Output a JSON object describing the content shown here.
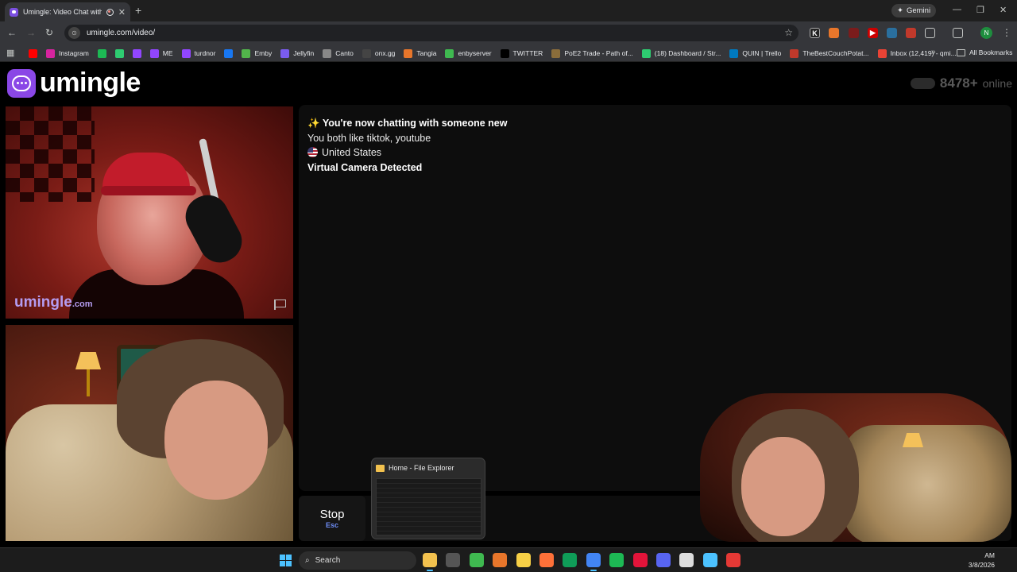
{
  "browser": {
    "tab_title": "Umingle: Video Chat with S",
    "url": "umingle.com/video/",
    "gemini_label": "Gemini",
    "profile_initial": "N",
    "bookmarks": [
      {
        "label": "",
        "color": "#ff0000"
      },
      {
        "label": "Instagram",
        "color": "#d6249f"
      },
      {
        "label": "",
        "color": "#1db954"
      },
      {
        "label": "",
        "color": "#2ecc71"
      },
      {
        "label": "",
        "color": "#9146ff"
      },
      {
        "label": "ME",
        "color": "#9146ff"
      },
      {
        "label": "turdnor",
        "color": "#9146ff"
      },
      {
        "label": "",
        "color": "#1877f2"
      },
      {
        "label": "Emby",
        "color": "#52b54b"
      },
      {
        "label": "Jellyfin",
        "color": "#7a5cf0"
      },
      {
        "label": "Canto",
        "color": "#888888"
      },
      {
        "label": "onx.gg",
        "color": "#444444"
      },
      {
        "label": "Tangia",
        "color": "#e8762b"
      },
      {
        "label": "enbyserver",
        "color": "#3fb950"
      },
      {
        "label": "TWITTER",
        "color": "#000000"
      },
      {
        "label": "PoE2 Trade - Path of...",
        "color": "#8a6d3b"
      },
      {
        "label": "(18) Dashboard / Str...",
        "color": "#2ecc71"
      },
      {
        "label": "QUIN | Trello",
        "color": "#0079bf"
      },
      {
        "label": "TheBestCouchPotat...",
        "color": "#c0392b"
      },
      {
        "label": "Inbox (12,419) - qmi...",
        "color": "#ea4335"
      }
    ],
    "all_bookmarks_label": "All Bookmarks"
  },
  "site": {
    "logo_text": "umingle",
    "online_count": "8478+",
    "online_label": "online",
    "watermark_main": "umingle",
    "watermark_suffix": ".com"
  },
  "chat": {
    "messages": [
      {
        "icon": "✨",
        "text": "You're now chatting with someone new",
        "bold": true
      },
      {
        "icon": "",
        "text": "You both like tiktok, youtube",
        "bold": false
      },
      {
        "icon": "us-flag",
        "text": "United States",
        "bold": false
      },
      {
        "icon": "",
        "text": "Virtual Camera Detected",
        "bold": true
      }
    ],
    "stop_label": "Stop",
    "stop_key": "Esc"
  },
  "taskbar": {
    "search_placeholder": "Search",
    "preview_title": "Home - File Explorer",
    "clock_time": "AM",
    "clock_date": "3/8/2026",
    "apps": [
      {
        "name": "file-explorer",
        "color": "#f2c14e",
        "active": true
      },
      {
        "name": "clock-app",
        "color": "#555555",
        "active": false
      },
      {
        "name": "run-app",
        "color": "#3fb950",
        "active": false
      },
      {
        "name": "browser-orange",
        "color": "#e8762b",
        "active": false
      },
      {
        "name": "sticky-notes",
        "color": "#f7d046",
        "active": false
      },
      {
        "name": "firefox",
        "color": "#ff7139",
        "active": false
      },
      {
        "name": "edge",
        "color": "#0f9d58",
        "active": false
      },
      {
        "name": "chrome",
        "color": "#4285f4",
        "active": true
      },
      {
        "name": "spotify",
        "color": "#1db954",
        "active": false
      },
      {
        "name": "opera",
        "color": "#e3143a",
        "active": false
      },
      {
        "name": "discord",
        "color": "#5865f2",
        "active": false
      },
      {
        "name": "steam",
        "color": "#dddddd",
        "active": false
      },
      {
        "name": "notepad",
        "color": "#4cc2ff",
        "active": false
      },
      {
        "name": "recorder",
        "color": "#e53935",
        "active": false
      }
    ]
  }
}
